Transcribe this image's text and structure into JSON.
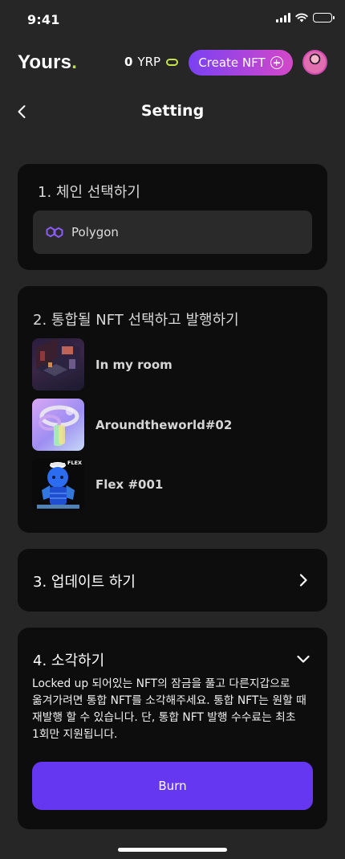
{
  "status_bar": {
    "time": "9:41"
  },
  "header": {
    "logo_text": "Yours",
    "logo_dot": ".",
    "balance_amount": "0",
    "balance_unit": "YRP",
    "create_button_label": "Create NFT"
  },
  "nav": {
    "title": "Setting"
  },
  "sections": {
    "chain": {
      "title": "1. 체인 선택하기",
      "selected_chain": "Polygon"
    },
    "merge": {
      "title": "2. 통합될 NFT 선택하고 발행하기",
      "items": [
        {
          "name": "In my room"
        },
        {
          "name": "Aroundtheworld#02"
        },
        {
          "name": "Flex #001"
        }
      ],
      "flex_badge": "FLEX"
    },
    "update": {
      "title": "3. 업데이트 하기"
    },
    "burn": {
      "title": "4. 소각하기",
      "description": "Locked up 되어있는 NFT의 잠금을 풀고 다른지갑으로 옮겨가려면 통합 NFT를 소각해주세요. 통합 NFT는 원할 때 재발행 할 수 있습니다. 단, 통합 NFT 발행 수수료는 최초 1회만 지원됩니다.",
      "button_label": "Burn"
    }
  },
  "colors": {
    "background": "#262626",
    "card": "#0d0d0d",
    "accent": "#6537f0",
    "gradient_start": "#7a41f3",
    "gradient_end": "#d448c8",
    "logo_dot": "#b7e33d"
  }
}
